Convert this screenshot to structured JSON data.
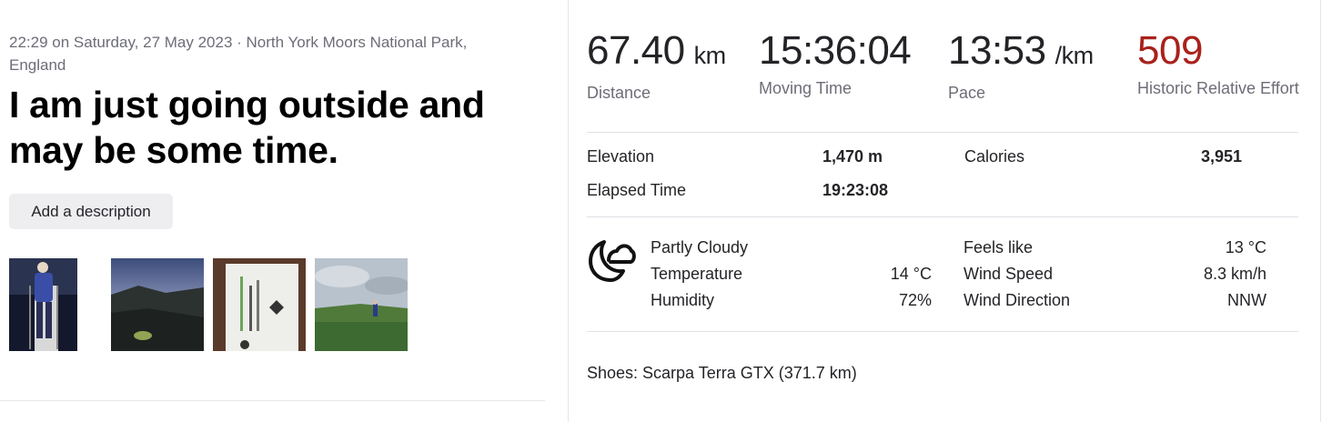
{
  "activity": {
    "meta": "22:29 on Saturday, 27 May 2023 · North York Moors National Park, England",
    "title": "I am just going outside and may be some time.",
    "add_description_label": "Add a description",
    "photos": [
      "photo-1",
      "photo-2",
      "photo-3",
      "photo-4"
    ]
  },
  "stats": {
    "distance": {
      "value": "67.40",
      "unit": "km",
      "label": "Distance"
    },
    "moving_time": {
      "value": "15:36:04",
      "label": "Moving Time"
    },
    "pace": {
      "value": "13:53",
      "unit": "/km",
      "label": "Pace"
    },
    "relative_effort": {
      "value": "509",
      "label": "Historic Relative Effort",
      "color": "#a8221c"
    }
  },
  "details": {
    "elevation": {
      "label": "Elevation",
      "value": "1,470 m"
    },
    "calories": {
      "label": "Calories",
      "value": "3,951"
    },
    "elapsed_time": {
      "label": "Elapsed Time",
      "value": "19:23:08"
    }
  },
  "weather": {
    "icon": "partly-cloudy-night-icon",
    "condition": "Partly Cloudy",
    "temperature": {
      "label": "Temperature",
      "value": "14 °C"
    },
    "humidity": {
      "label": "Humidity",
      "value": "72%"
    },
    "feels_like": {
      "label": "Feels like",
      "value": "13 °C"
    },
    "wind_speed": {
      "label": "Wind Speed",
      "value": "8.3 km/h"
    },
    "wind_direction": {
      "label": "Wind Direction",
      "value": "NNW"
    }
  },
  "gear": {
    "shoes": "Shoes: Scarpa Terra GTX (371.7 km)"
  }
}
